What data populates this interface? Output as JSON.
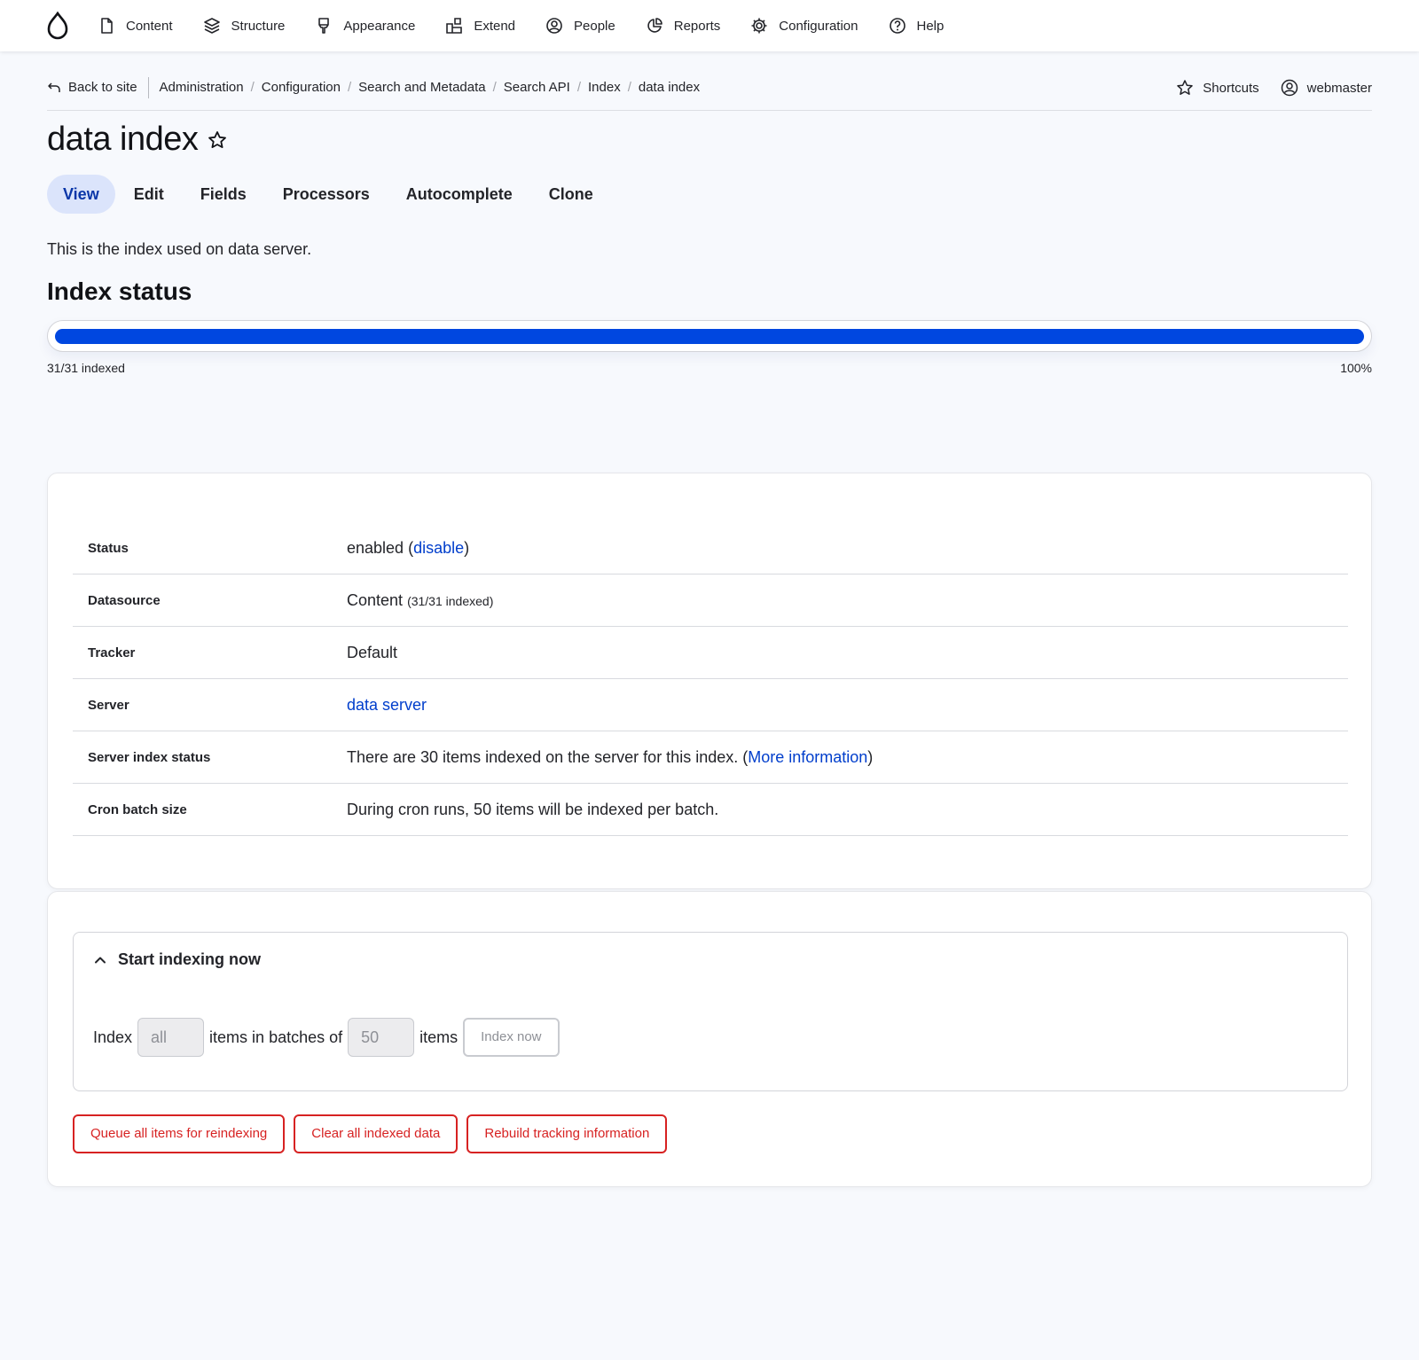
{
  "toolbar": {
    "logo_icon": "drupal-drop-icon",
    "items": [
      {
        "label": "Content",
        "icon": "document-icon"
      },
      {
        "label": "Structure",
        "icon": "layers-icon"
      },
      {
        "label": "Appearance",
        "icon": "brush-icon"
      },
      {
        "label": "Extend",
        "icon": "puzzle-icon"
      },
      {
        "label": "People",
        "icon": "user-circle-icon"
      },
      {
        "label": "Reports",
        "icon": "pie-chart-icon"
      },
      {
        "label": "Configuration",
        "icon": "gear-icon"
      },
      {
        "label": "Help",
        "icon": "question-icon"
      }
    ]
  },
  "secondary": {
    "back_label": "Back to site",
    "breadcrumbs": [
      "Administration",
      "Configuration",
      "Search and Metadata",
      "Search API",
      "Index",
      "data index"
    ],
    "shortcuts_label": "Shortcuts",
    "user_label": "webmaster"
  },
  "page": {
    "title": "data index",
    "tabs": [
      "View",
      "Edit",
      "Fields",
      "Processors",
      "Autocomplete",
      "Clone"
    ],
    "active_tab": "View",
    "description": "This is the index used on data server."
  },
  "index_status": {
    "heading": "Index status",
    "progress_fraction": 1.0,
    "indexed_label": "31/31 indexed",
    "percent_label": "100%"
  },
  "info": {
    "status": {
      "label": "Status",
      "value_prefix": "enabled (",
      "link": "disable",
      "value_suffix": ")"
    },
    "datasource": {
      "label": "Datasource",
      "value": "Content",
      "detail": "(31/31 indexed)"
    },
    "tracker": {
      "label": "Tracker",
      "value": "Default"
    },
    "server": {
      "label": "Server",
      "link": "data server"
    },
    "server_index_status": {
      "label": "Server index status",
      "value_prefix": "There are 30 items indexed on the server for this index. (",
      "link": "More information",
      "value_suffix": ")"
    },
    "cron": {
      "label": "Cron batch size",
      "value": "During cron runs, 50 items will be indexed per batch."
    }
  },
  "indexing": {
    "summary": "Start indexing now",
    "index_label": "Index",
    "limit_placeholder": "all",
    "middle_label": "items in batches of",
    "batch_placeholder": "50",
    "items_label": "items",
    "index_now_label": "Index now"
  },
  "actions": {
    "queue_label": "Queue all items for reindexing",
    "clear_label": "Clear all indexed data",
    "rebuild_label": "Rebuild tracking information"
  },
  "colors": {
    "accent": "#0047e0",
    "link": "#003ecc",
    "danger": "#d72222",
    "active_tab_bg": "#dbe4fb"
  }
}
